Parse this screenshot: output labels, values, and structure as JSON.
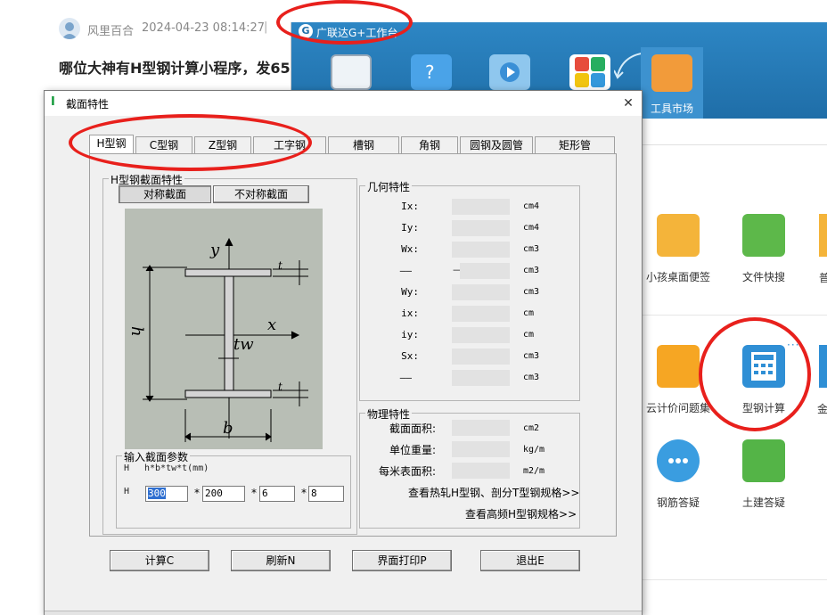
{
  "forum": {
    "author": "风里百合",
    "date": "2024-04-23 08:14:27",
    "separator": "|",
    "title": "哪位大神有H型钢计算小程序，发65..."
  },
  "workbench": {
    "title": "广联达G+工作台",
    "logo": "G",
    "tools_tab": "工具市场",
    "apps": [
      {
        "label": "小孩桌面便签",
        "icon": "kid-note-icon"
      },
      {
        "label": "文件快搜",
        "icon": "file-search-icon"
      },
      {
        "label": "云计价问题集",
        "icon": "cloud-pricing-icon"
      },
      {
        "label": "型钢计算",
        "icon": "steel-calculator-icon"
      },
      {
        "label": "钢筋答疑",
        "icon": "rebar-chat-icon"
      },
      {
        "label": "土建答疑",
        "icon": "civil-answer-icon"
      }
    ],
    "clipped_label_1": "普",
    "clipped_label_2": "金",
    "more": "···"
  },
  "dialog": {
    "icon": "I",
    "title": "截面特性",
    "close": "✕",
    "tabs": [
      "H型钢",
      "C型钢",
      "Z型钢",
      "工字钢",
      "槽钢",
      "角钢",
      "圆钢及圆管",
      "矩形管"
    ],
    "section_group": "H型钢截面特性",
    "sym_button": "对称截面",
    "asym_button": "不对称截面",
    "diagram_labels": {
      "y": "y",
      "x": "x",
      "h": "h",
      "tw": "tw",
      "b": "b",
      "t1": "t",
      "t2": "t"
    },
    "geo_group": "几何特性",
    "geo_rows": [
      {
        "label": "Ix:",
        "unit": "cm4"
      },
      {
        "label": "Iy:",
        "unit": "cm4"
      },
      {
        "label": "Wx:",
        "unit": "cm3"
      },
      {
        "label": "——",
        "unit": "cm3",
        "mid": "—"
      },
      {
        "label": "Wy:",
        "unit": "cm3"
      },
      {
        "label": "ix:",
        "unit": "cm"
      },
      {
        "label": "iy:",
        "unit": "cm"
      },
      {
        "label": "Sx:",
        "unit": "cm3"
      },
      {
        "label": "——",
        "unit": "cm3"
      }
    ],
    "phys_group": "物理特性",
    "phys_rows": [
      {
        "label": "截面面积:",
        "unit": "cm2"
      },
      {
        "label": "单位重量:",
        "unit": "kg/m"
      },
      {
        "label": "每米表面积:",
        "unit": "m2/m"
      }
    ],
    "link_hot": "查看热轧H型钢、剖分T型钢规格>>",
    "link_high": "查看高频H型钢规格>>",
    "input_group": "输入截面参数",
    "input_formula_prefix": "H",
    "input_formula": "h*b*tw*t(mm)",
    "input_prefix": "H",
    "inputs": {
      "h": "300",
      "b": "200",
      "tw": "6",
      "t": "8"
    },
    "mul": "*",
    "buttons": {
      "calc": "计算C",
      "refresh": "刷新N",
      "print": "界面打印P",
      "exit": "退出E"
    }
  }
}
